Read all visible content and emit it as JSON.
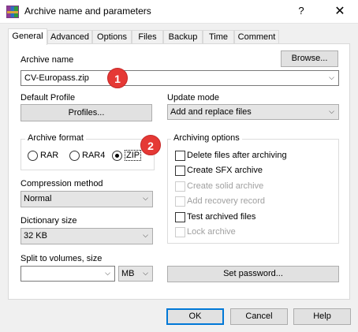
{
  "window": {
    "title": "Archive name and parameters",
    "help_glyph": "?",
    "close_glyph": "✕"
  },
  "tabs": [
    "General",
    "Advanced",
    "Options",
    "Files",
    "Backup",
    "Time",
    "Comment"
  ],
  "archive_name": {
    "label": "Archive name",
    "browse": "Browse...",
    "value": "CV-Europass.zip"
  },
  "default_profile": {
    "label": "Default Profile",
    "button": "Profiles..."
  },
  "update_mode": {
    "label": "Update mode",
    "value": "Add and replace files"
  },
  "archive_format": {
    "label": "Archive format",
    "options": [
      "RAR",
      "RAR4",
      "ZIP"
    ],
    "selected": "ZIP"
  },
  "archiving_options": {
    "label": "Archiving options",
    "items": [
      {
        "label": "Delete files after archiving",
        "checked": false,
        "enabled": true
      },
      {
        "label": "Create SFX archive",
        "checked": false,
        "enabled": true
      },
      {
        "label": "Create solid archive",
        "checked": false,
        "enabled": false
      },
      {
        "label": "Add recovery record",
        "checked": false,
        "enabled": false
      },
      {
        "label": "Test archived files",
        "checked": false,
        "enabled": true
      },
      {
        "label": "Lock archive",
        "checked": false,
        "enabled": false
      }
    ]
  },
  "compression": {
    "label": "Compression method",
    "value": "Normal"
  },
  "dictionary": {
    "label": "Dictionary size",
    "value": "32 KB"
  },
  "split": {
    "label": "Split to volumes, size",
    "value": "",
    "unit": "MB"
  },
  "set_password": "Set password...",
  "footer": {
    "ok": "OK",
    "cancel": "Cancel",
    "help": "Help"
  },
  "badges": [
    "1",
    "2"
  ],
  "colors": {
    "badge": "#e53935",
    "focus": "#0078d7"
  }
}
